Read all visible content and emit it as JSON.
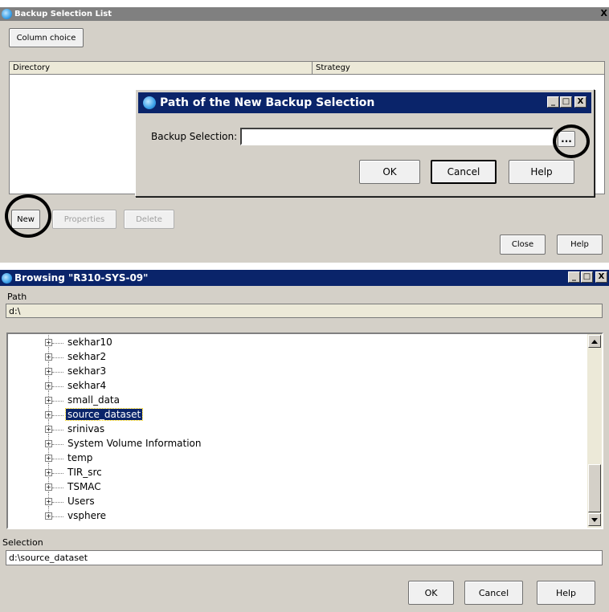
{
  "backup_list": {
    "title": "Backup Selection List",
    "close_glyph": "X",
    "column_choice_label": "Column choice",
    "columns": [
      "Directory",
      "Strategy"
    ],
    "new_label": "New",
    "properties_label": "Properties",
    "delete_label": "Delete",
    "close_label": "Close",
    "help_label": "Help"
  },
  "path_dialog": {
    "title": "Path of the New Backup Selection",
    "field_label": "Backup Selection:",
    "field_value": "",
    "browse_label": "...",
    "ok_label": "OK",
    "cancel_label": "Cancel",
    "help_label": "Help"
  },
  "browse_dialog": {
    "title": "Browsing \"R310-SYS-09\"",
    "path_label": "Path",
    "path_value": "d:\\",
    "tree_items": [
      {
        "label": "sekhar10",
        "selected": false
      },
      {
        "label": "sekhar2",
        "selected": false
      },
      {
        "label": "sekhar3",
        "selected": false
      },
      {
        "label": "sekhar4",
        "selected": false
      },
      {
        "label": "small_data",
        "selected": false
      },
      {
        "label": "source_dataset",
        "selected": true
      },
      {
        "label": "srinivas",
        "selected": false
      },
      {
        "label": "System Volume Information",
        "selected": false
      },
      {
        "label": "temp",
        "selected": false
      },
      {
        "label": "TIR_src",
        "selected": false
      },
      {
        "label": "TSMAC",
        "selected": false
      },
      {
        "label": "Users",
        "selected": false
      },
      {
        "label": "vsphere",
        "selected": false
      }
    ],
    "selection_label": "Selection",
    "selection_value": "d:\\source_dataset",
    "ok_label": "OK",
    "cancel_label": "Cancel",
    "help_label": "Help"
  },
  "window_buttons": {
    "minimize": "_",
    "maximize": "□",
    "close": "X"
  },
  "icons": {
    "app": "gear-globe-icon",
    "scroll_up": "scroll-up-arrow-icon",
    "scroll_down": "scroll-down-arrow-icon",
    "expand": "expand-plus-icon"
  },
  "colors": {
    "title_active": "#0a246a",
    "title_inactive": "#808080",
    "dialog_bg": "#d4d0c8",
    "selection_bg": "#0a246a"
  }
}
